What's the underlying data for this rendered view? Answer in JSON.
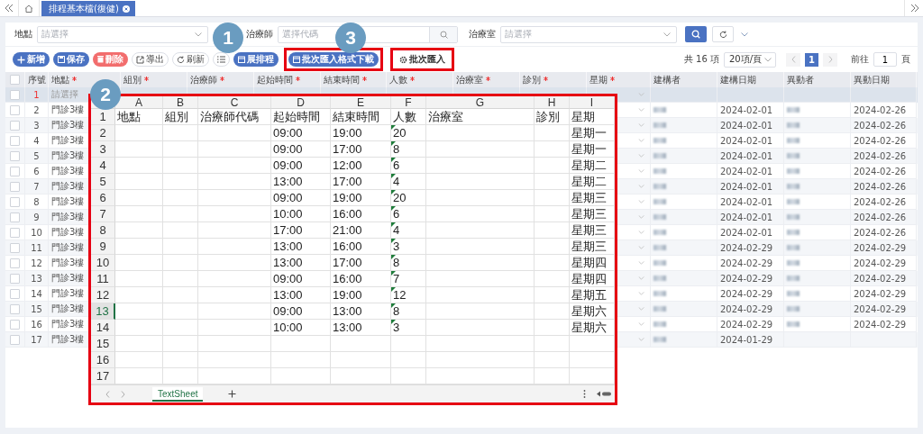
{
  "top_bar": {
    "tabs": [
      {
        "label": "排程基本檔(復健)",
        "selected": true
      }
    ]
  },
  "filters": [
    {
      "label": "地點",
      "placeholder": "請選擇",
      "kind": "select"
    },
    {
      "label": "治療師",
      "placeholder": "選擇代碼",
      "kind": "search"
    },
    {
      "label": "治療室",
      "placeholder": "請選擇",
      "kind": "select"
    }
  ],
  "toolbar": [
    {
      "label": "新增",
      "kind": "add",
      "highlighted": false
    },
    {
      "label": "保存",
      "kind": "save",
      "highlighted": false
    },
    {
      "label": "刪除",
      "kind": "delete",
      "highlighted": false
    },
    {
      "label": "導出",
      "kind": "export",
      "highlighted": false
    },
    {
      "label": "刷新",
      "kind": "refresh",
      "highlighted": false
    },
    {
      "kind": "list",
      "highlighted": false
    },
    {
      "label": "展排程",
      "kind": "schedule",
      "highlighted": false
    },
    {
      "label": "批次匯入格式下載",
      "kind": "schedule",
      "highlighted": true
    },
    {
      "label": "批次匯入",
      "kind": "import",
      "highlighted": true
    }
  ],
  "pagination": {
    "total": "共 16 項",
    "page_size": "20項/頁",
    "pages": [
      {
        "label": "1",
        "selected": true
      }
    ],
    "goto_label": "前往",
    "goto_value": "1",
    "page_unit": "頁"
  },
  "table": {
    "select_all_checked": false,
    "columns": [
      {
        "label": "序號",
        "required": false
      },
      {
        "label": "地點",
        "required": true
      },
      {
        "label": "組別",
        "required": true
      },
      {
        "label": "治療師",
        "required": true
      },
      {
        "label": "起始時間",
        "required": true
      },
      {
        "label": "結束時間",
        "required": true
      },
      {
        "label": "人數",
        "required": true
      },
      {
        "label": "治療室",
        "required": true
      },
      {
        "label": "診別",
        "required": true
      },
      {
        "label": "星期",
        "required": true
      },
      {
        "label": "建構者",
        "required": false
      },
      {
        "label": "建構日期",
        "required": false
      },
      {
        "label": "異動者",
        "required": false
      },
      {
        "label": "異動日期",
        "required": false
      }
    ],
    "rows": [
      {
        "index": "1",
        "checked": false,
        "new": true,
        "selected": true,
        "location_placeholder": "請選擇",
        "creator_redacted": false,
        "modifier_redacted": false
      },
      {
        "index": "2",
        "checked": false,
        "new": false,
        "selected": false,
        "location": "門診3樓",
        "creator_redacted": true,
        "created": "2024-02-01",
        "modifier_redacted": true,
        "modified": "2024-02-26"
      },
      {
        "index": "3",
        "checked": false,
        "new": false,
        "selected": false,
        "location": "門診3樓",
        "creator_redacted": true,
        "created": "2024-02-01",
        "modifier_redacted": true,
        "modified": "2024-02-26"
      },
      {
        "index": "4",
        "checked": false,
        "new": false,
        "selected": false,
        "location": "門診3樓",
        "creator_redacted": true,
        "created": "2024-02-01",
        "modifier_redacted": true,
        "modified": "2024-02-26"
      },
      {
        "index": "5",
        "checked": false,
        "new": false,
        "selected": false,
        "location": "門診3樓",
        "creator_redacted": true,
        "created": "2024-02-01",
        "modifier_redacted": true,
        "modified": "2024-02-26"
      },
      {
        "index": "6",
        "checked": false,
        "new": false,
        "selected": false,
        "location": "門診3樓",
        "creator_redacted": true,
        "created": "2024-02-01",
        "modifier_redacted": true,
        "modified": "2024-02-26"
      },
      {
        "index": "7",
        "checked": false,
        "new": false,
        "selected": false,
        "location": "門診3樓",
        "creator_redacted": true,
        "created": "2024-02-01",
        "modifier_redacted": true,
        "modified": "2024-02-26"
      },
      {
        "index": "8",
        "checked": false,
        "new": false,
        "selected": false,
        "location": "門診3樓",
        "creator_redacted": true,
        "created": "2024-02-01",
        "modifier_redacted": true,
        "modified": "2024-02-26"
      },
      {
        "index": "9",
        "checked": false,
        "new": false,
        "selected": false,
        "location": "門診3樓",
        "creator_redacted": true,
        "created": "2024-02-01",
        "modifier_redacted": true,
        "modified": "2024-02-26"
      },
      {
        "index": "10",
        "checked": false,
        "new": false,
        "selected": false,
        "location": "門診3樓",
        "creator_redacted": true,
        "created": "2024-02-01",
        "modifier_redacted": true,
        "modified": "2024-02-26"
      },
      {
        "index": "11",
        "checked": false,
        "new": false,
        "selected": false,
        "location": "門診3樓",
        "creator_redacted": true,
        "created": "2024-02-29",
        "modifier_redacted": true,
        "modified": "2024-02-29"
      },
      {
        "index": "12",
        "checked": false,
        "new": false,
        "selected": false,
        "location": "門診3樓",
        "creator_redacted": true,
        "created": "2024-02-29",
        "modifier_redacted": true,
        "modified": "2024-02-29"
      },
      {
        "index": "13",
        "checked": false,
        "new": false,
        "selected": false,
        "location": "門診3樓",
        "creator_redacted": true,
        "created": "2024-02-29",
        "modifier_redacted": true,
        "modified": "2024-02-29"
      },
      {
        "index": "14",
        "checked": false,
        "new": false,
        "selected": false,
        "location": "門診3樓",
        "creator_redacted": true,
        "created": "2024-02-29",
        "modifier_redacted": true,
        "modified": "2024-02-29"
      },
      {
        "index": "15",
        "checked": false,
        "new": false,
        "selected": false,
        "location": "門診3樓",
        "creator_redacted": true,
        "created": "2024-02-29",
        "modifier_redacted": true,
        "modified": "2024-02-29"
      },
      {
        "index": "16",
        "checked": false,
        "new": false,
        "selected": false,
        "location": "門診3樓",
        "creator_redacted": true,
        "created": "2024-02-29",
        "modifier_redacted": true,
        "modified": "2024-02-29"
      },
      {
        "index": "17",
        "checked": false,
        "new": false,
        "selected": false,
        "location": "門診3樓",
        "creator_redacted": true,
        "created": "2024-01-29",
        "modifier_redacted": false
      }
    ]
  },
  "spreadsheet": {
    "columns": [
      "A",
      "B",
      "C",
      "D",
      "E",
      "F",
      "G",
      "H",
      "I"
    ],
    "rows": [
      {
        "number": "1",
        "selected": false,
        "flagged": false,
        "cells": {
          "A": "地點",
          "B": "組別",
          "C": "治療師代碼",
          "D": "起始時間",
          "E": "結束時間",
          "F": "人數",
          "G": "治療室",
          "H": "診別",
          "I": "星期"
        }
      },
      {
        "number": "2",
        "selected": false,
        "flagged": true,
        "cells": {
          "D": "09:00",
          "E": "19:00",
          "F": "20",
          "I": "星期一"
        }
      },
      {
        "number": "3",
        "selected": false,
        "flagged": true,
        "cells": {
          "D": "09:00",
          "E": "17:00",
          "F": "8",
          "I": "星期一"
        }
      },
      {
        "number": "4",
        "selected": false,
        "flagged": true,
        "cells": {
          "D": "09:00",
          "E": "12:00",
          "F": "6",
          "I": "星期二"
        }
      },
      {
        "number": "5",
        "selected": false,
        "flagged": true,
        "cells": {
          "D": "13:00",
          "E": "17:00",
          "F": "4",
          "I": "星期二"
        }
      },
      {
        "number": "6",
        "selected": false,
        "flagged": true,
        "cells": {
          "D": "09:00",
          "E": "19:00",
          "F": "20",
          "I": "星期三"
        }
      },
      {
        "number": "7",
        "selected": false,
        "flagged": true,
        "cells": {
          "D": "10:00",
          "E": "16:00",
          "F": "6",
          "I": "星期三"
        }
      },
      {
        "number": "8",
        "selected": false,
        "flagged": true,
        "cells": {
          "D": "17:00",
          "E": "21:00",
          "F": "4",
          "I": "星期三"
        }
      },
      {
        "number": "9",
        "selected": false,
        "flagged": true,
        "cells": {
          "D": "13:00",
          "E": "16:00",
          "F": "3",
          "I": "星期三"
        }
      },
      {
        "number": "10",
        "selected": false,
        "flagged": true,
        "cells": {
          "D": "13:00",
          "E": "17:00",
          "F": "8",
          "I": "星期四"
        }
      },
      {
        "number": "11",
        "selected": false,
        "flagged": true,
        "cells": {
          "D": "09:00",
          "E": "16:00",
          "F": "7",
          "I": "星期四"
        }
      },
      {
        "number": "12",
        "selected": false,
        "flagged": true,
        "cells": {
          "D": "13:00",
          "E": "19:00",
          "F": "12",
          "I": "星期五"
        }
      },
      {
        "number": "13",
        "selected": true,
        "flagged": true,
        "cells": {
          "D": "09:00",
          "E": "13:00",
          "F": "8",
          "I": "星期六"
        }
      },
      {
        "number": "14",
        "selected": false,
        "flagged": true,
        "cells": {
          "D": "10:00",
          "E": "13:00",
          "F": "3",
          "I": "星期六"
        }
      },
      {
        "number": "15",
        "selected": false,
        "flagged": false,
        "cells": {}
      },
      {
        "number": "16",
        "selected": false,
        "flagged": false,
        "cells": {}
      },
      {
        "number": "17",
        "selected": false,
        "flagged": false,
        "cells": {}
      }
    ],
    "sheet_tabs": [
      {
        "label": "TextSheet",
        "selected": true
      }
    ]
  },
  "callouts": [
    {
      "label": "1"
    },
    {
      "label": "2"
    },
    {
      "label": "3"
    }
  ]
}
